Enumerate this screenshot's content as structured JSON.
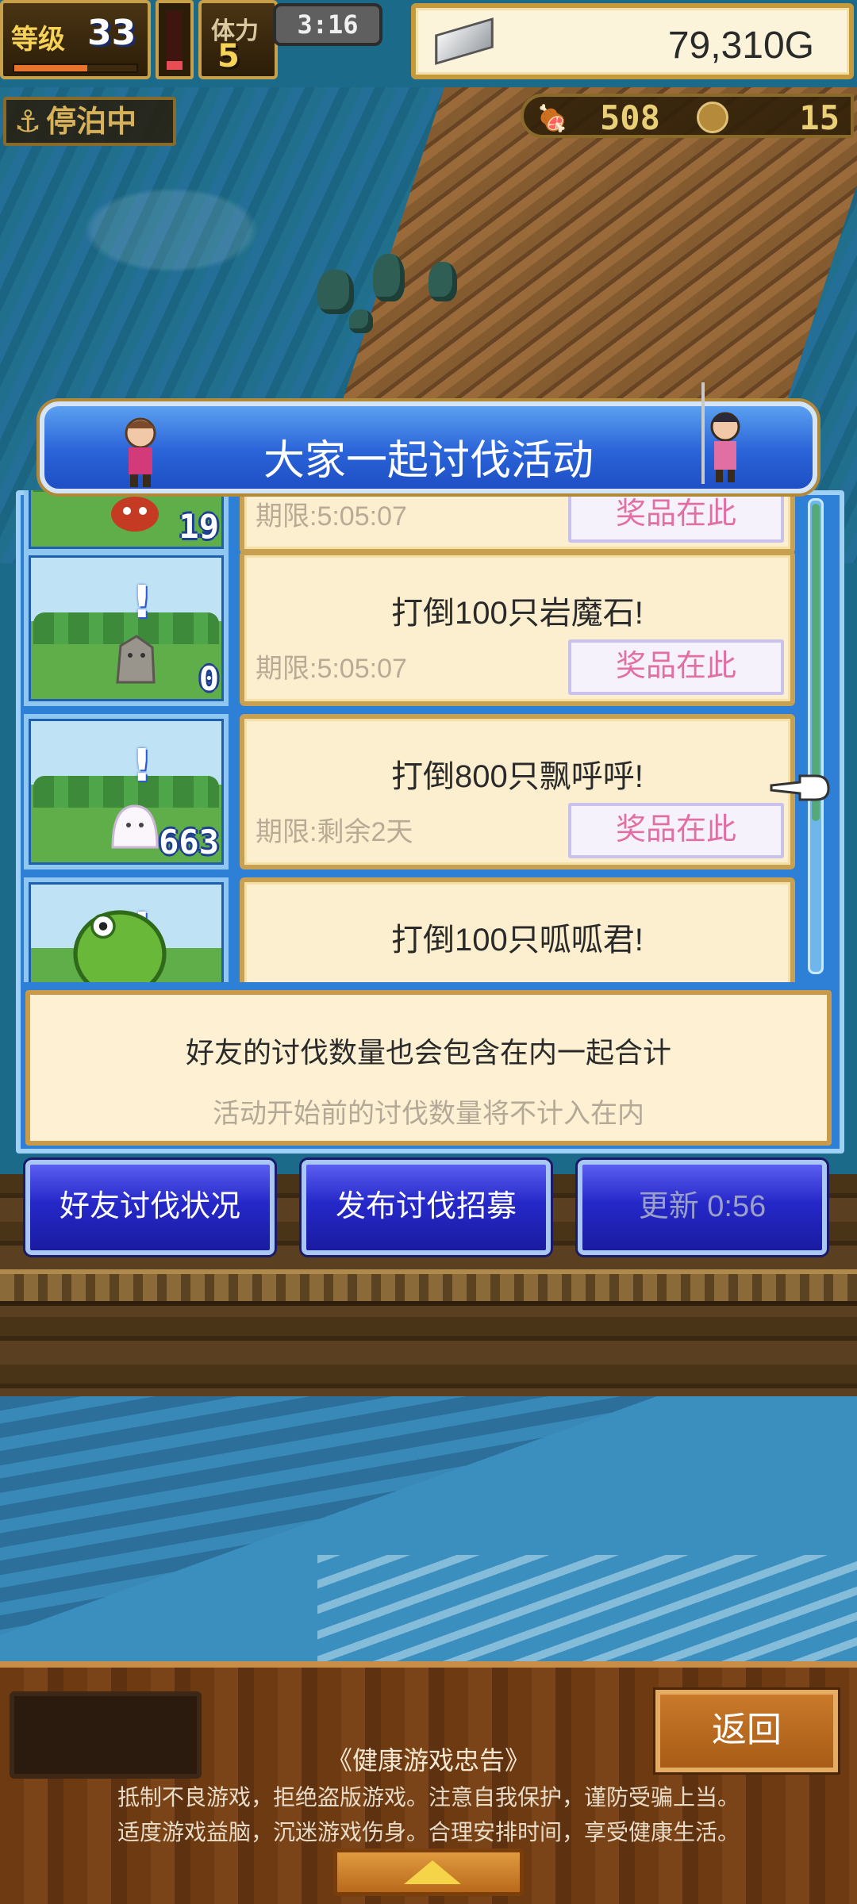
{
  "hud": {
    "level_label": "等级",
    "level": "33",
    "stamina_label": "体力",
    "stamina": "5",
    "clock": "3:16",
    "gold": "79,310G",
    "status": "停泊中",
    "food": "508",
    "medals": "15"
  },
  "event": {
    "title": "大家一起讨伐活动",
    "tasks": [
      {
        "goal": "",
        "count": "19",
        "deadline": "期限:5:05:07",
        "prize_label": "奖品在此",
        "monster_icon": "red-monster-icon"
      },
      {
        "goal": "打倒100只岩魔石!",
        "count": "0",
        "deadline": "期限:5:05:07",
        "prize_label": "奖品在此",
        "monster_icon": "rock-golem-icon"
      },
      {
        "goal": "打倒800只飘呼呼!",
        "count": "663",
        "deadline": "期限:剩余2天",
        "prize_label": "奖品在此",
        "monster_icon": "ghost-icon"
      },
      {
        "goal": "打倒100只呱呱君!",
        "count": "",
        "deadline": "",
        "prize_label": "",
        "monster_icon": "frog-icon"
      }
    ],
    "note_main": "好友的讨伐数量也会包含在内一起合计",
    "note_sub": "活动开始前的讨伐数量将不计入在内"
  },
  "buttons": {
    "friends_status": "好友讨伐状况",
    "post_recruit": "发布讨伐招募",
    "refresh": "更新 0:56"
  },
  "footer": {
    "back": "返回",
    "advisory_title": "《健康游戏忠告》",
    "advisory_line1": "抵制不良游戏，拒绝盗版游戏。注意自我保护，谨防受骗上当。",
    "advisory_line2": "适度游戏益脑，沉迷游戏伤身。合理安排时间，享受健康生活。"
  },
  "levels": {
    "exp_fraction": 0.6,
    "stamina_fraction": 0.15
  },
  "colors": {
    "panel_blue": "#2a63d8",
    "prize_text": "#e26fa4",
    "gold_frame": "#c69a3a"
  }
}
